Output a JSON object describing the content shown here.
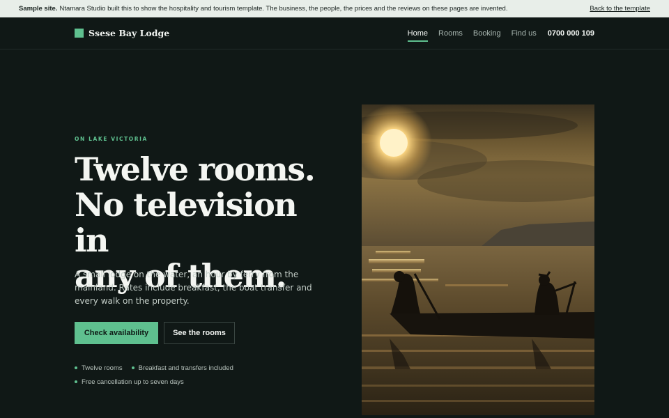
{
  "notice": {
    "label": "Sample site.",
    "text": "Ntamara Studio built this to show the hospitality and tourism template. The business, the people, the prices and the reviews on these pages are invented.",
    "back_link": "Back to the template"
  },
  "header": {
    "brand": "Ssese Bay Lodge",
    "nav": [
      {
        "label": "Home",
        "active": true
      },
      {
        "label": "Rooms",
        "active": false
      },
      {
        "label": "Booking",
        "active": false
      },
      {
        "label": "Find us",
        "active": false
      }
    ],
    "phone": "0700 000 109"
  },
  "hero": {
    "eyebrow": "ON LAKE VICTORIA",
    "headline_lines": [
      "Twelve rooms.",
      "No television in",
      "any of them."
    ],
    "lede": "A small lodge on the water, an hour by ferry from the mainland. Rates include breakfast, the boat transfer and every walk on the property.",
    "primary_cta": "Check availability",
    "secondary_cta": "See the rooms",
    "perks": [
      "Twelve rooms",
      "Breakfast and transfers included",
      "Free cancellation up to seven days"
    ]
  },
  "colors": {
    "background": "#101816",
    "accent": "#5fc08f",
    "notice_bar": "#e8eee9"
  },
  "icons": {
    "brand_mark": "square-logo-icon",
    "perk_bullet": "dot-icon"
  }
}
